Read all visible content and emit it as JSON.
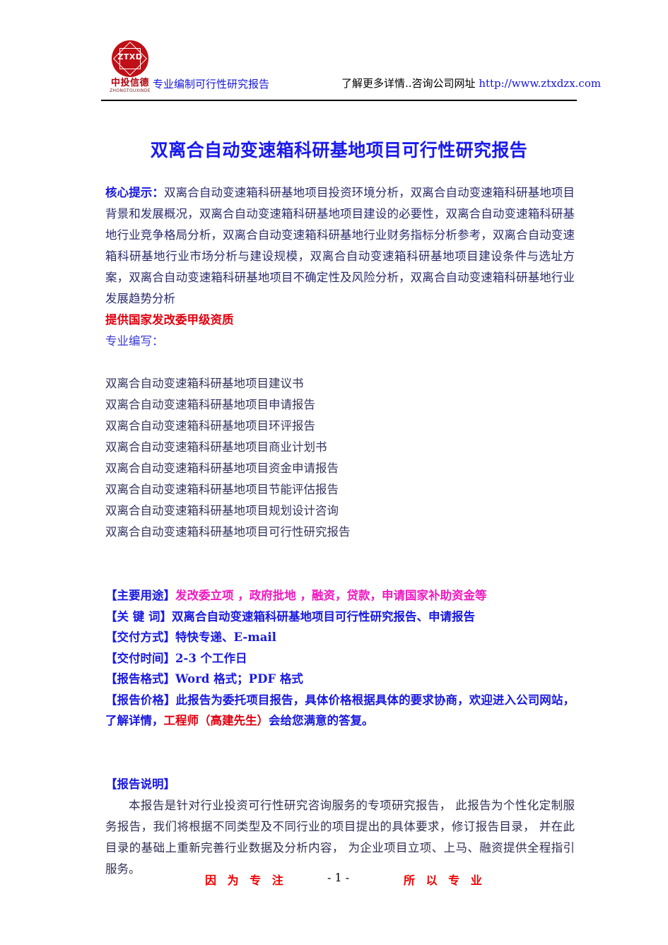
{
  "header": {
    "logo": {
      "icon_name": "company-seal-logo",
      "letters": "ZTXD",
      "company_cn": "中投信德",
      "company_en": "ZHONGTOUXINDE"
    },
    "left_text": "专业编制可行性研究报告",
    "right_prefix": "了解更多详情..咨询公司网址 ",
    "right_url": "http://www.ztxdzx.com"
  },
  "title": "双离合自动变速箱科研基地项目可行性研究报告",
  "core_tip": {
    "label": "核心提示",
    "separator": "：",
    "body": "双离合自动变速箱科研基地项目投资环境分析，双离合自动变速箱科研基地项目背景和发展概况，双离合自动变速箱科研基地项目建设的必要性，双离合自动变速箱科研基地行业竞争格局分析，双离合自动变速箱科研基地行业财务指标分析参考，双离合自动变速箱科研基地行业市场分析与建设规模，双离合自动变速箱科研基地项目建设条件与选址方案，双离合自动变速箱科研基地项目不确定性及风险分析，双离合自动变速箱科研基地行业发展趋势分析"
  },
  "qualification_line": "提供国家发改委甲级资质",
  "professional_line": "专业编写：",
  "documents": [
    "双离合自动变速箱科研基地项目建议书",
    "双离合自动变速箱科研基地项目申请报告",
    "双离合自动变速箱科研基地项目环评报告",
    "双离合自动变速箱科研基地项目商业计划书",
    "双离合自动变速箱科研基地项目资金申请报告",
    "双离合自动变速箱科研基地项目节能评估报告",
    "双离合自动变速箱科研基地项目规划设计咨询",
    "双离合自动变速箱科研基地项目可行性研究报告"
  ],
  "info_rows": [
    {
      "key": "【主要用途】",
      "value": "发改委立项 ，政府批地 ，融资，贷款，申请国家补助资金等",
      "value_color": "magenta"
    },
    {
      "key": "【关 键 词】",
      "value": "双离合自动变速箱科研基地项目可行性研究报告、申请报告",
      "value_color": "blue"
    },
    {
      "key": "【交付方式】",
      "value": "特快专递、E-mail",
      "value_color": "blue"
    },
    {
      "key": "【交付时间】",
      "value": "2-3 个工作日",
      "value_color": "blue"
    },
    {
      "key": "【报告格式】",
      "value": "Word 格式；PDF 格式",
      "value_color": "blue"
    }
  ],
  "price_row": {
    "key": "【报告价格】",
    "value_part1": "此报告为委托项目报告，具体价格根据具体的要求协商，欢迎进入公司网站，了解详情，",
    "value_highlight": "工程师（高建先生）",
    "value_part2": "会给您满意的答复。"
  },
  "explanation": {
    "heading": "【报告说明】",
    "body": "本报告是针对行业投资可行性研究咨询服务的专项研究报告， 此报告为个性化定制服务报告，我们将根据不同类型及不同行业的项目提出的具体要求，修订报告目录， 并在此目录的基础上重新完善行业数据及分析内容， 为企业项目立项、上马、融资提供全程指引服务。"
  },
  "footer": {
    "left": "因 为 专 注",
    "page_number": "- 1 -",
    "right": "所 以 专 业"
  },
  "colors": {
    "title_blue": "#1a1aee",
    "label_blue": "#1a1ae0",
    "body_navy": "#2b2b6e",
    "accent_red": "#e2000f",
    "accent_magenta": "#ef1ac0",
    "footer_red": "#ee0000",
    "logo_red": "#c00f16"
  }
}
